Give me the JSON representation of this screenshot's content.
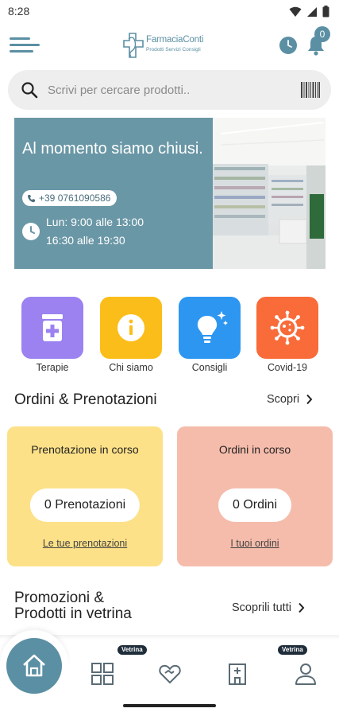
{
  "status_bar": {
    "time": "8:28",
    "icons": [
      "wifi-icon",
      "signal-icon",
      "battery-icon"
    ]
  },
  "header": {
    "logo_name": "FarmaciaConti",
    "logo_tagline": "Prodotti Servizi Consigli",
    "notification_count": "0",
    "accent_color": "#5b8fa3"
  },
  "search": {
    "placeholder": "Scrivi per cercare prodotti.."
  },
  "info": {
    "status_title": "Al momento siamo chiusi.",
    "phone": "+39 0761090586",
    "hours_line1": "Lun: 9:00 alle 13:00",
    "hours_line2": "16:30 alle 19:30",
    "banner_color": "#6a97a6"
  },
  "quick_actions": [
    {
      "label": "Terapie",
      "icon": "medicine-bottle-icon",
      "color": "#9b82f0"
    },
    {
      "label": "Chi siamo",
      "icon": "info-icon",
      "color": "#fbbd1a"
    },
    {
      "label": "Consigli",
      "icon": "lightbulb-icon",
      "color": "#2d96f0"
    },
    {
      "label": "Covid-19",
      "icon": "virus-icon",
      "color": "#f96b39"
    }
  ],
  "orders_section": {
    "title": "Ordini & Prenotazioni",
    "link": "Scopri",
    "cards": [
      {
        "title": "Prenotazione in corso",
        "count": "0 Prenotazioni",
        "link": "Le tue prenotazioni",
        "color": "#fde188"
      },
      {
        "title": "Ordini in corso",
        "count": "0 Ordini",
        "link": "I tuoi ordini",
        "color": "#f5bcab"
      }
    ]
  },
  "promo_section": {
    "title_line1": "Promozioni &",
    "title_line2": "Prodotti in vetrina",
    "link": "Scoprili tutti",
    "badge_label": "Vetrina"
  },
  "bottom_nav": {
    "items": [
      "home-icon",
      "grid-icon",
      "heart-handshake-icon",
      "pharmacy-building-icon",
      "user-icon"
    ]
  }
}
